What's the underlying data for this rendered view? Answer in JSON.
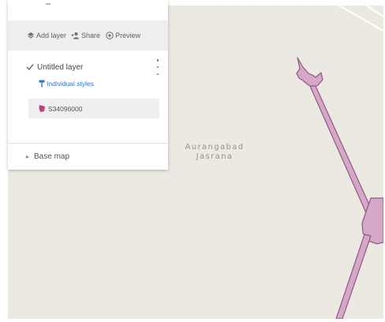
{
  "map": {
    "place_label_line1": "Aurangabad",
    "place_label_line2": "Jasrana",
    "land_color": "#ece8e2",
    "feature_fill_color": "#d6a8c8",
    "feature_stroke_color": "#8e5a80"
  },
  "panel": {
    "toolbar": {
      "add_layer_label": "Add layer",
      "share_label": "Share",
      "preview_label": "Preview"
    },
    "layer": {
      "name": "Untitled layer",
      "checked": true,
      "styles_label": "Individual styles",
      "feature_name": "S34096000",
      "feature_color": "#b8437e"
    },
    "basemap_label": "Base map"
  }
}
